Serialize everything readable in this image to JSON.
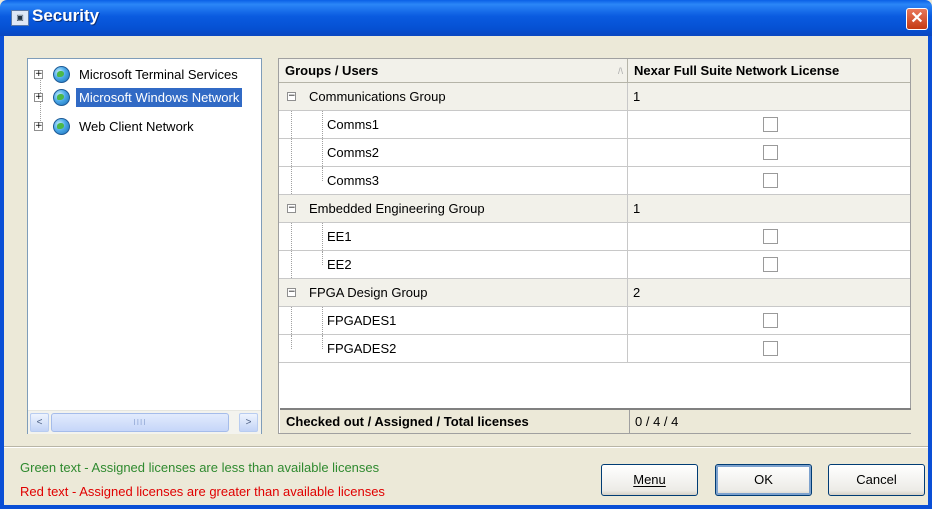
{
  "window": {
    "title": "Security",
    "icon": "app-icon",
    "close_glyph": "✕"
  },
  "tree": {
    "items": [
      {
        "label": "Microsoft Terminal Services",
        "icon": "globe-icon",
        "expander": "+",
        "selected": false
      },
      {
        "label": "Microsoft Windows Network",
        "icon": "globe-icon",
        "expander": "+",
        "selected": true
      },
      {
        "label": "Web Client Network",
        "icon": "globe-icon",
        "expander": "+",
        "selected": false
      }
    ],
    "scrollbar": {
      "left": "<",
      "right": ">",
      "grip": "IIII"
    }
  },
  "grid": {
    "columns": [
      "Groups / Users",
      "Nexar Full Suite Network License"
    ],
    "sort_glyph": "/\\",
    "groups": [
      {
        "name": "Communications Group",
        "value": "1",
        "expander": "−",
        "users": [
          "Comms1",
          "Comms2",
          "Comms3"
        ]
      },
      {
        "name": "Embedded Engineering Group",
        "value": "1",
        "expander": "−",
        "users": [
          "EE1",
          "EE2"
        ]
      },
      {
        "name": "FPGA Design Group",
        "value": "2",
        "expander": "−",
        "users": [
          "FPGADES1",
          "FPGADES2"
        ]
      }
    ],
    "footer": {
      "label": "Checked out / Assigned / Total licenses",
      "value": "0 / 4 / 4"
    }
  },
  "legend": {
    "green": "Green text - Assigned licenses are less than available licenses",
    "red": "Red text   - Assigned licenses are greater than available licenses",
    "colors": {
      "green": "#2f8a2f",
      "red": "#e00000"
    }
  },
  "buttons": {
    "menu": "Menu",
    "ok": "OK",
    "cancel": "Cancel"
  }
}
